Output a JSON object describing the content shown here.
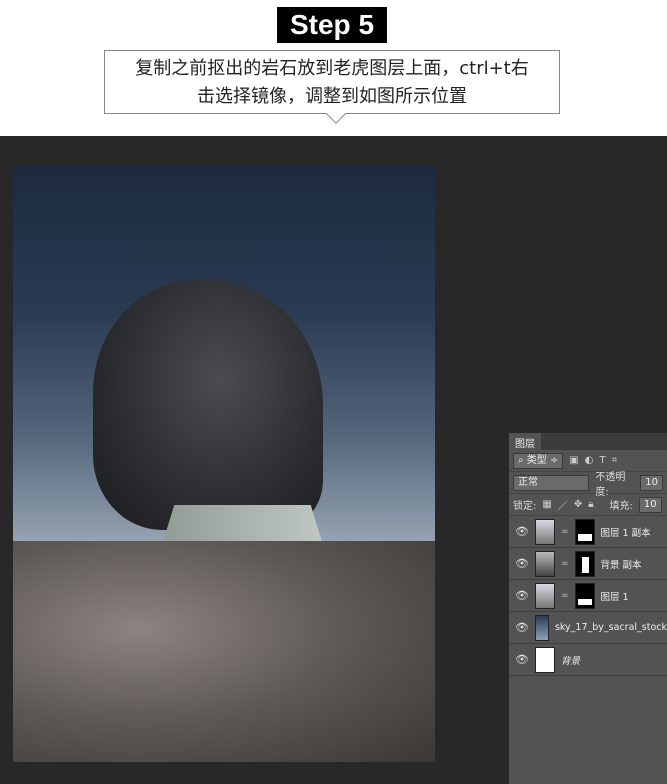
{
  "header": {
    "step": "Step 5",
    "instruction_line1": "复制之前抠出的岩石放到老虎图层上面，ctrl+t右",
    "instruction_line2": "击选择镜像，调整到如图所示位置"
  },
  "layers_panel": {
    "tab": "图层",
    "filter": "类型",
    "blend_mode": "正常",
    "opacity_label": "不透明度:",
    "opacity_value": "10",
    "lock_label": "锁定:",
    "fill_label": "填充:",
    "fill_value": "10",
    "layers": [
      {
        "name": "图层 1 副本"
      },
      {
        "name": "背景 副本"
      },
      {
        "name": "图层 1"
      },
      {
        "name": "sky_17_by_sacral_stock"
      },
      {
        "name": "背景"
      }
    ]
  }
}
